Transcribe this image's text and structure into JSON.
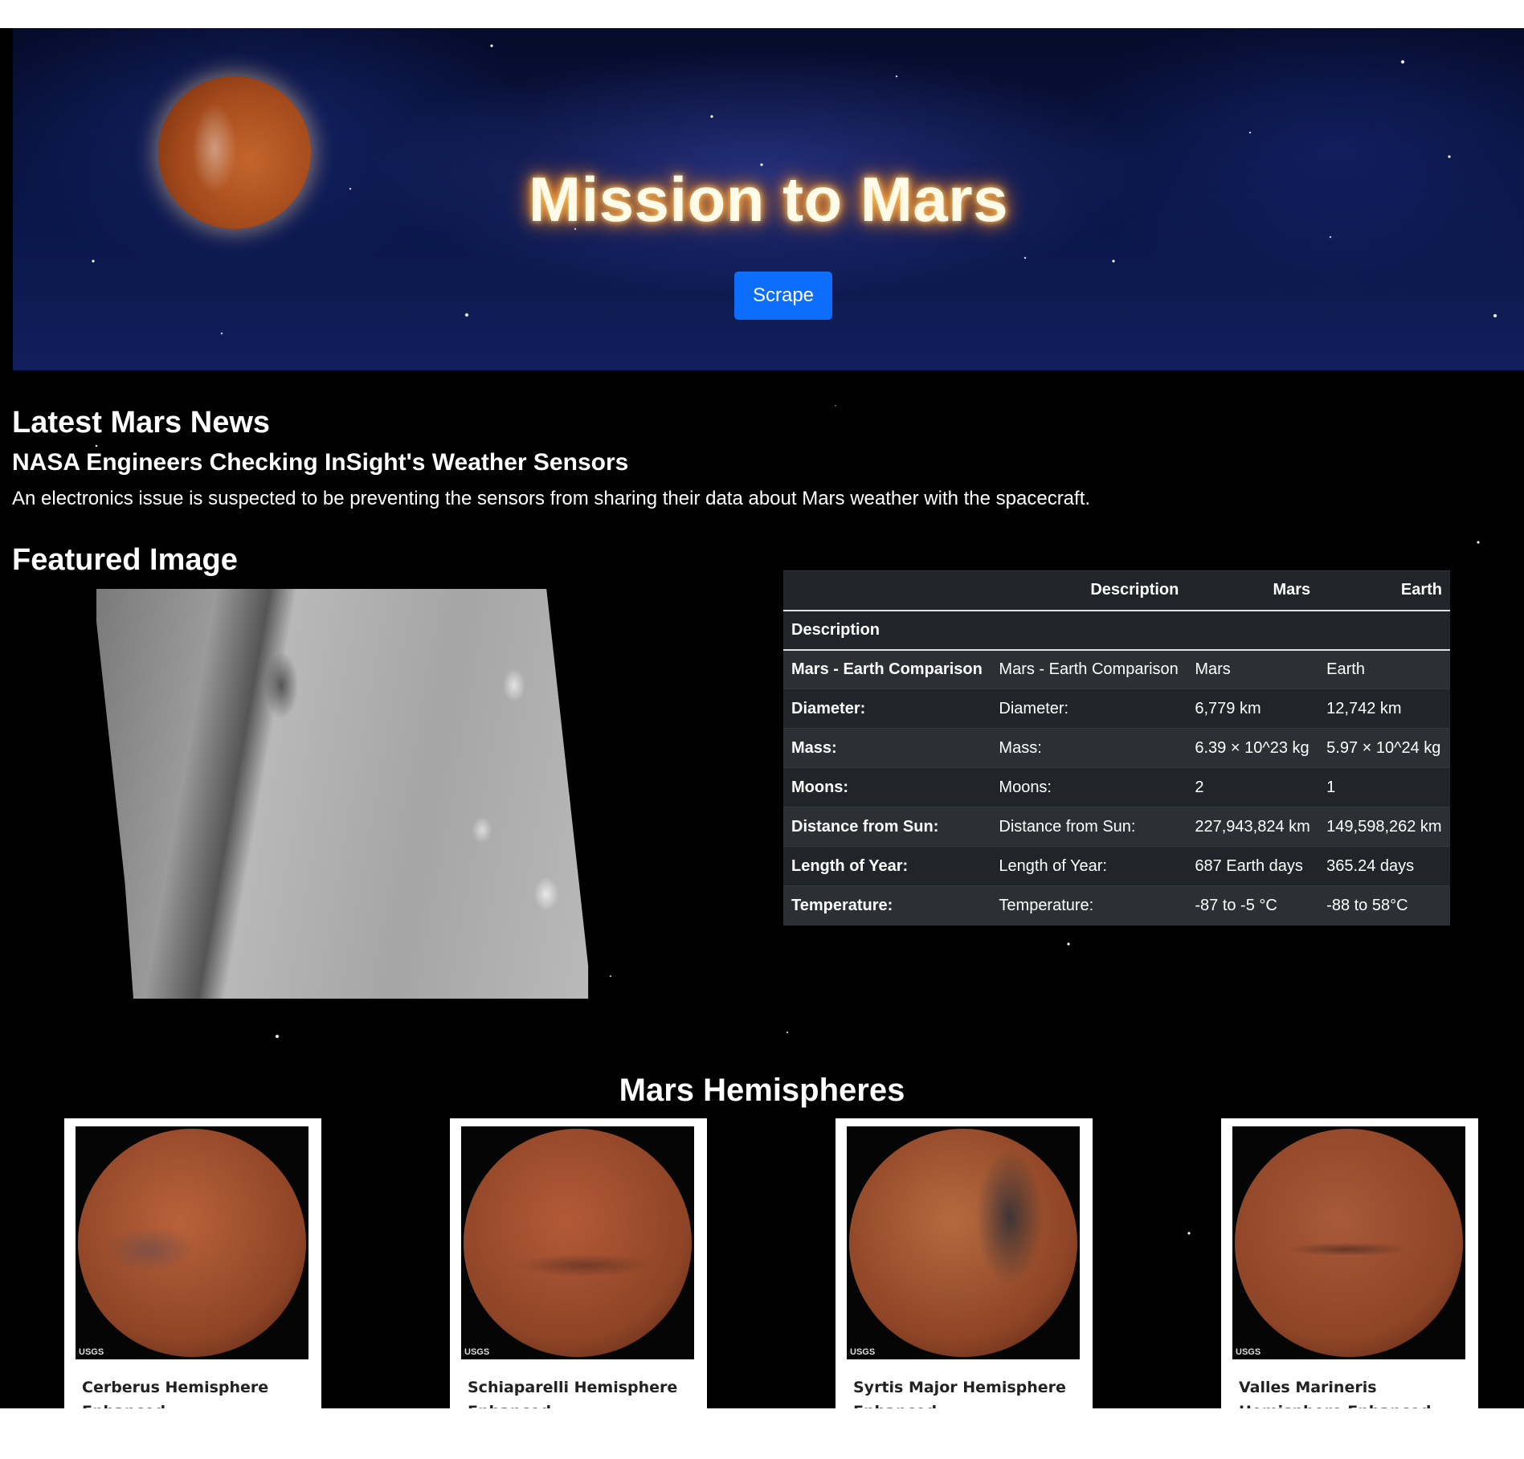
{
  "header": {
    "title": "Mission to Mars",
    "scrape_label": "Scrape"
  },
  "news": {
    "heading": "Latest Mars News",
    "title": "NASA Engineers Checking InSight's Weather Sensors",
    "paragraph": "An electronics issue is suspected to be preventing the sensors from sharing their data about Mars weather with the spacecraft."
  },
  "featured": {
    "heading": "Featured Image"
  },
  "facts_table": {
    "columns": [
      "Description",
      "Mars",
      "Earth"
    ],
    "index_label": "Description",
    "rows": [
      {
        "key": "Mars - Earth Comparison",
        "description": "Mars - Earth Comparison",
        "mars": "Mars",
        "earth": "Earth"
      },
      {
        "key": "Diameter:",
        "description": "Diameter:",
        "mars": "6,779 km",
        "earth": "12,742 km"
      },
      {
        "key": "Mass:",
        "description": "Mass:",
        "mars": "6.39 × 10^23 kg",
        "earth": "5.97 × 10^24 kg"
      },
      {
        "key": "Moons:",
        "description": "Moons:",
        "mars": "2",
        "earth": "1"
      },
      {
        "key": "Distance from Sun:",
        "description": "Distance from Sun:",
        "mars": "227,943,824 km",
        "earth": "149,598,262 km"
      },
      {
        "key": "Length of Year:",
        "description": "Length of Year:",
        "mars": "687 Earth days",
        "earth": "365.24 days"
      },
      {
        "key": "Temperature:",
        "description": "Temperature:",
        "mars": "-87 to -5 °C",
        "earth": "-88 to 58°C"
      }
    ]
  },
  "hemispheres": {
    "heading": "Mars Hemispheres",
    "logo_text": "USGS",
    "items": [
      {
        "title": "Cerberus Hemisphere Enhanced",
        "color": "#b8623a"
      },
      {
        "title": "Schiaparelli Hemisphere Enhanced",
        "color": "#b35a38"
      },
      {
        "title": "Syrtis Major Hemisphere Enhanced",
        "color": "#b46b3e"
      },
      {
        "title": "Valles Marineris Hemisphere Enhanced",
        "color": "#a85a3a"
      }
    ]
  },
  "colors": {
    "button": "#0d6efd",
    "table_bg": "#212529"
  }
}
